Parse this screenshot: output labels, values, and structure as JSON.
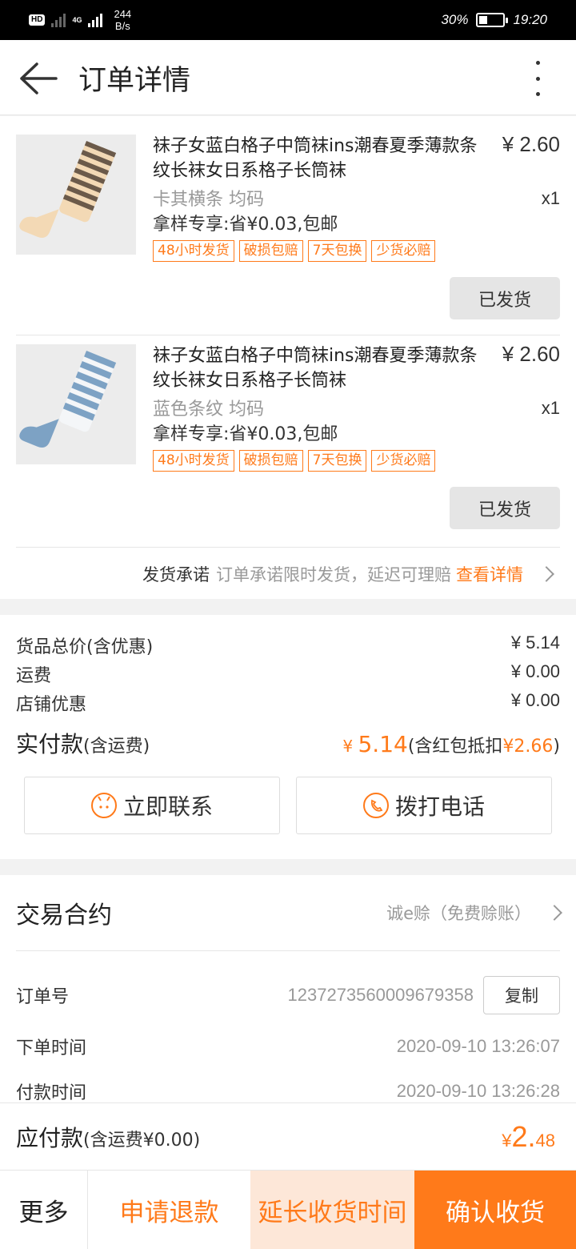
{
  "status_bar": {
    "hd_label": "HD",
    "network": "4G",
    "speed": "244",
    "speed_unit": "B/s",
    "battery": "30%",
    "time": "19:20"
  },
  "header": {
    "title": "订单详情"
  },
  "products": [
    {
      "name": "袜子女蓝白格子中筒袜ins潮春夏季薄款条纹长袜女日系格子长筒袜",
      "price": "¥ 2.60",
      "spec": "卡其横条 均码",
      "qty": "x1",
      "promo": "拿样专享:省¥0.03,包邮",
      "tags": [
        "48小时发货",
        "破损包赔",
        "7天包换",
        "少货必赔"
      ],
      "status": "已发货"
    },
    {
      "name": "袜子女蓝白格子中筒袜ins潮春夏季薄款条纹长袜女日系格子长筒袜",
      "price": "¥ 2.60",
      "spec": "蓝色条纹 均码",
      "qty": "x1",
      "promo": "拿样专享:省¥0.03,包邮",
      "tags": [
        "48小时发货",
        "破损包赔",
        "7天包换",
        "少货必赔"
      ],
      "status": "已发货"
    }
  ],
  "promise": {
    "label": "发货承诺",
    "desc": "订单承诺限时发货，延迟可理赔",
    "link": "查看详情"
  },
  "summary": {
    "goods_label": "货品总价(含优惠)",
    "goods_value": "¥ 5.14",
    "shipping_label": "运费",
    "shipping_value": "¥ 0.00",
    "discount_label": "店铺优惠",
    "discount_value": "¥ 0.00",
    "paid_label": "实付款",
    "paid_sub": "(含运费)",
    "paid_currency": "¥ ",
    "paid_amount": "5.14",
    "paid_note_prefix": "(含红包抵扣",
    "paid_note_amount": "¥2.66",
    "paid_note_suffix": ")",
    "contact_btn": "立即联系",
    "call_btn": "拨打电话"
  },
  "contract": {
    "title": "交易合约",
    "value": "诚e赊（免费赊账）",
    "order_no_label": "订单号",
    "order_no": "1237273560009679358",
    "copy_btn": "复制",
    "order_time_label": "下单时间",
    "order_time": "2020-09-10 13:26:07",
    "pay_time_label": "付款时间",
    "pay_time": "2020-09-10 13:26:28"
  },
  "payable": {
    "label": "应付款",
    "sub": "(含运费¥0.00)",
    "currency": "¥",
    "amount_int": "2.",
    "amount_dec": "48"
  },
  "actions": {
    "more": "更多",
    "refund": "申请退款",
    "extend": "延长收货时间",
    "confirm": "确认收货"
  },
  "colors": {
    "accent": "#ff7a1a",
    "extend_bg": "#fde7d8"
  }
}
